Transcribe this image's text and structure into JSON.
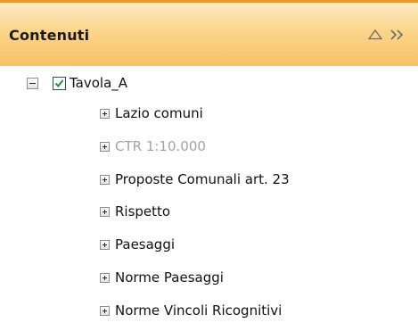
{
  "panel": {
    "title": "Contenuti",
    "collapse_icon": "triangle-up-icon",
    "expand_icon": "double-chevron-right-icon",
    "header_color": "#fbd58a",
    "accent_color": "#f09a1c"
  },
  "tree": {
    "root": {
      "label": "Tavola_A",
      "checked": true,
      "expanded": true
    },
    "children": [
      {
        "label": "Lazio comuni",
        "disabled": false
      },
      {
        "label": "CTR 1:10.000",
        "disabled": true
      },
      {
        "label": "Proposte Comunali art. 23",
        "disabled": false
      },
      {
        "label": "Rispetto",
        "disabled": false
      },
      {
        "label": "Paesaggi",
        "disabled": false
      },
      {
        "label": "Norme Paesaggi",
        "disabled": false
      },
      {
        "label": "Norme Vincoli Ricognitivi",
        "disabled": false
      }
    ]
  }
}
